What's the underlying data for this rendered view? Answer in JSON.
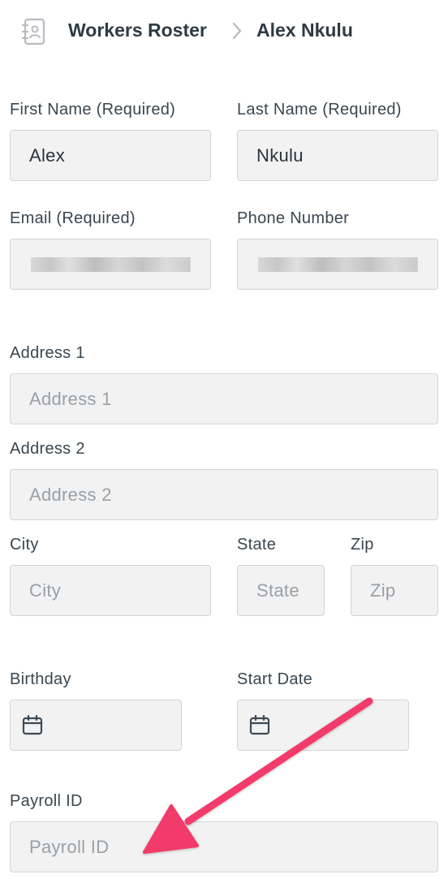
{
  "breadcrumb": {
    "icon": "contact-book-icon",
    "root_label": "Workers Roster",
    "separator_icon": "chevron-right-icon",
    "current_label": "Alex Nkulu"
  },
  "form": {
    "first_name": {
      "label": "First Name (Required)",
      "value": "Alex"
    },
    "last_name": {
      "label": "Last Name (Required)",
      "value": "Nkulu"
    },
    "email": {
      "label": "Email (Required)",
      "value": "",
      "obscured": true
    },
    "phone": {
      "label": "Phone Number",
      "value": "",
      "obscured": true
    },
    "address1": {
      "label": "Address 1",
      "placeholder": "Address 1"
    },
    "address2": {
      "label": "Address 2",
      "placeholder": "Address 2"
    },
    "city": {
      "label": "City",
      "placeholder": "City"
    },
    "state": {
      "label": "State",
      "placeholder": "State"
    },
    "zip": {
      "label": "Zip",
      "placeholder": "Zip"
    },
    "birthday": {
      "label": "Birthday",
      "icon": "calendar-icon"
    },
    "start_date": {
      "label": "Start Date",
      "icon": "calendar-icon"
    },
    "payroll_id": {
      "label": "Payroll ID",
      "placeholder": "Payroll ID"
    }
  },
  "annotation": {
    "type": "arrow",
    "color": "#f23a6b",
    "target": "payroll-id-input"
  }
}
